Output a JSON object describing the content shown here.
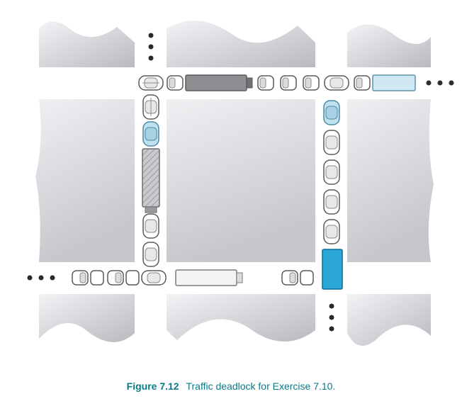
{
  "caption": {
    "label": "Figure 7.12",
    "text": "Traffic deadlock for Exercise 7.10."
  },
  "diagram": {
    "type": "traffic-deadlock-gridlock",
    "description": "Top-down view of a city block with four intersections. Vehicles on each road occupy the intersections so that each direction is blocked by vehicles from the perpendicular road, forming a circular-wait deadlock.",
    "roads": {
      "top": {
        "direction": "east",
        "ellipsis": "right"
      },
      "bottom": {
        "direction": "west",
        "ellipsis": "left"
      },
      "left_vertical": {
        "direction": "south",
        "ellipsis": "top"
      },
      "right_vertical": {
        "direction": "north",
        "ellipsis": "bottom"
      }
    },
    "vehicles": {
      "top_road_east": [
        {
          "kind": "car",
          "color": "white"
        },
        {
          "kind": "car-back",
          "color": "white"
        },
        {
          "kind": "truck",
          "color": "dark-gray"
        },
        {
          "kind": "car-back",
          "color": "white"
        },
        {
          "kind": "car-back",
          "color": "white"
        },
        {
          "kind": "car-back",
          "color": "white"
        },
        {
          "kind": "car-back",
          "color": "white"
        },
        {
          "kind": "truck",
          "color": "light-blue"
        }
      ],
      "left_road_south": [
        {
          "kind": "car",
          "color": "white"
        },
        {
          "kind": "car",
          "color": "light-blue"
        },
        {
          "kind": "truck",
          "color": "hatched-gray"
        },
        {
          "kind": "car",
          "color": "white"
        },
        {
          "kind": "car",
          "color": "white"
        }
      ],
      "bottom_road_west": [
        {
          "kind": "car-back",
          "color": "white"
        },
        {
          "kind": "car-back",
          "color": "white"
        },
        {
          "kind": "car",
          "color": "white"
        },
        {
          "kind": "truck",
          "color": "white"
        },
        {
          "kind": "car-back",
          "color": "white"
        },
        {
          "kind": "truck",
          "color": "cyan"
        }
      ],
      "right_road_north": [
        {
          "kind": "car",
          "color": "light-blue"
        },
        {
          "kind": "car",
          "color": "white"
        },
        {
          "kind": "car",
          "color": "white"
        },
        {
          "kind": "car",
          "color": "white"
        },
        {
          "kind": "car",
          "color": "white"
        }
      ]
    },
    "colors": {
      "building-light": "#e9eaec",
      "building-dark": "#bfc1c6",
      "road": "#ffffff",
      "car-white": "#ffffff",
      "car-outline": "#4a4a4a",
      "truck-dark": "#8d8f93",
      "truck-light-blue": "#cfe8f4",
      "truck-hatched": "#b9bbbf",
      "truck-white": "#f4f4f4",
      "truck-cyan": "#2aa7d6",
      "car-light-blue": "#bfe1ef",
      "ellipsis": "#2b2b2b"
    }
  }
}
